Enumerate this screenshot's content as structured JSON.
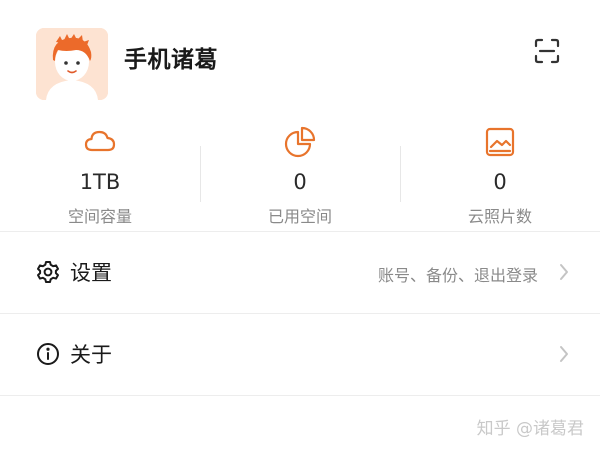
{
  "profile": {
    "name": "手机诸葛"
  },
  "stats": [
    {
      "value": "1TB",
      "label": "空间容量",
      "icon": "cloud-icon"
    },
    {
      "value": "0",
      "label": "已用空间",
      "icon": "pie-chart-icon"
    },
    {
      "value": "0",
      "label": "云照片数",
      "icon": "photo-icon"
    }
  ],
  "menu": {
    "settings": {
      "label": "设置",
      "subtitle": "账号、备份、退出登录",
      "icon": "gear-icon"
    },
    "about": {
      "label": "关于",
      "icon": "info-icon"
    }
  },
  "watermark": "知乎 @诸葛君",
  "colors": {
    "accent": "#e8742c",
    "avatar_bg": "#fde3d2",
    "text_primary": "#1a1a1a",
    "text_secondary": "#8a8a8a"
  }
}
